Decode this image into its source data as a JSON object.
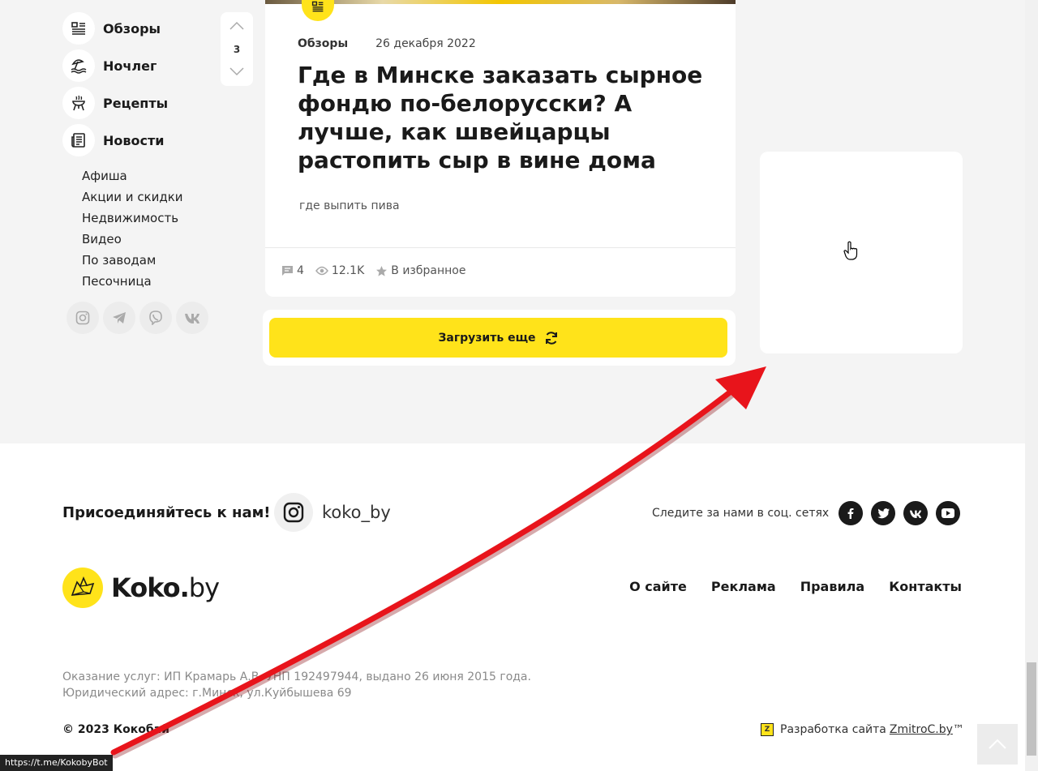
{
  "sidebar": {
    "items": [
      {
        "label": "Обзоры",
        "icon": "list-icon"
      },
      {
        "label": "Ночлег",
        "icon": "beach-icon"
      },
      {
        "label": "Рецепты",
        "icon": "grill-icon"
      },
      {
        "label": "Новости",
        "icon": "newspaper-icon"
      }
    ],
    "subitems": [
      "Афиша",
      "Акции и скидки",
      "Недвижимость",
      "Видео",
      "По заводам",
      "Песочница"
    ],
    "socials": [
      "instagram-icon",
      "telegram-icon",
      "viber-icon",
      "vk-icon"
    ]
  },
  "pager": {
    "value": "3"
  },
  "article": {
    "category": "Обзоры",
    "date": "26 декабря 2022",
    "title": "Где в Минске заказать сырное фондю по-белорусски? А лучше, как швейцарцы растопить сыр в вине дома",
    "tag": "где выпить пива",
    "comments": "4",
    "views": "12.1K",
    "favorite_label": "В избранное"
  },
  "load_more": {
    "label": "Загрузить еще"
  },
  "footer": {
    "join_text": "Присоединяйтесь к нам!",
    "instagram_handle": "koko_by",
    "follow_text": "Следите за нами в соц. сетях",
    "socials": [
      "facebook-icon",
      "twitter-icon",
      "vk-icon",
      "youtube-icon"
    ],
    "logo_main": "Koko.",
    "logo_suffix": "by",
    "links": [
      "О сайте",
      "Реклама",
      "Правила",
      "Контакты"
    ],
    "legal_line1": "Оказание услуг: ИП Крамарь А.В. УНП 192497944, выдано 26 июня 2015 года.",
    "legal_line2": "Юридический адрес: г.Минск, ул.Куйбышева 69",
    "copyright": "© 2023 Кокобай",
    "dev_prefix": "Разработка сайта",
    "dev_link": "ZmitroC.by",
    "dev_suffix": "™"
  },
  "status_url": "https://t.me/KokobyBot",
  "colors": {
    "accent": "#ffe31a",
    "arrow": "#e8141b"
  }
}
